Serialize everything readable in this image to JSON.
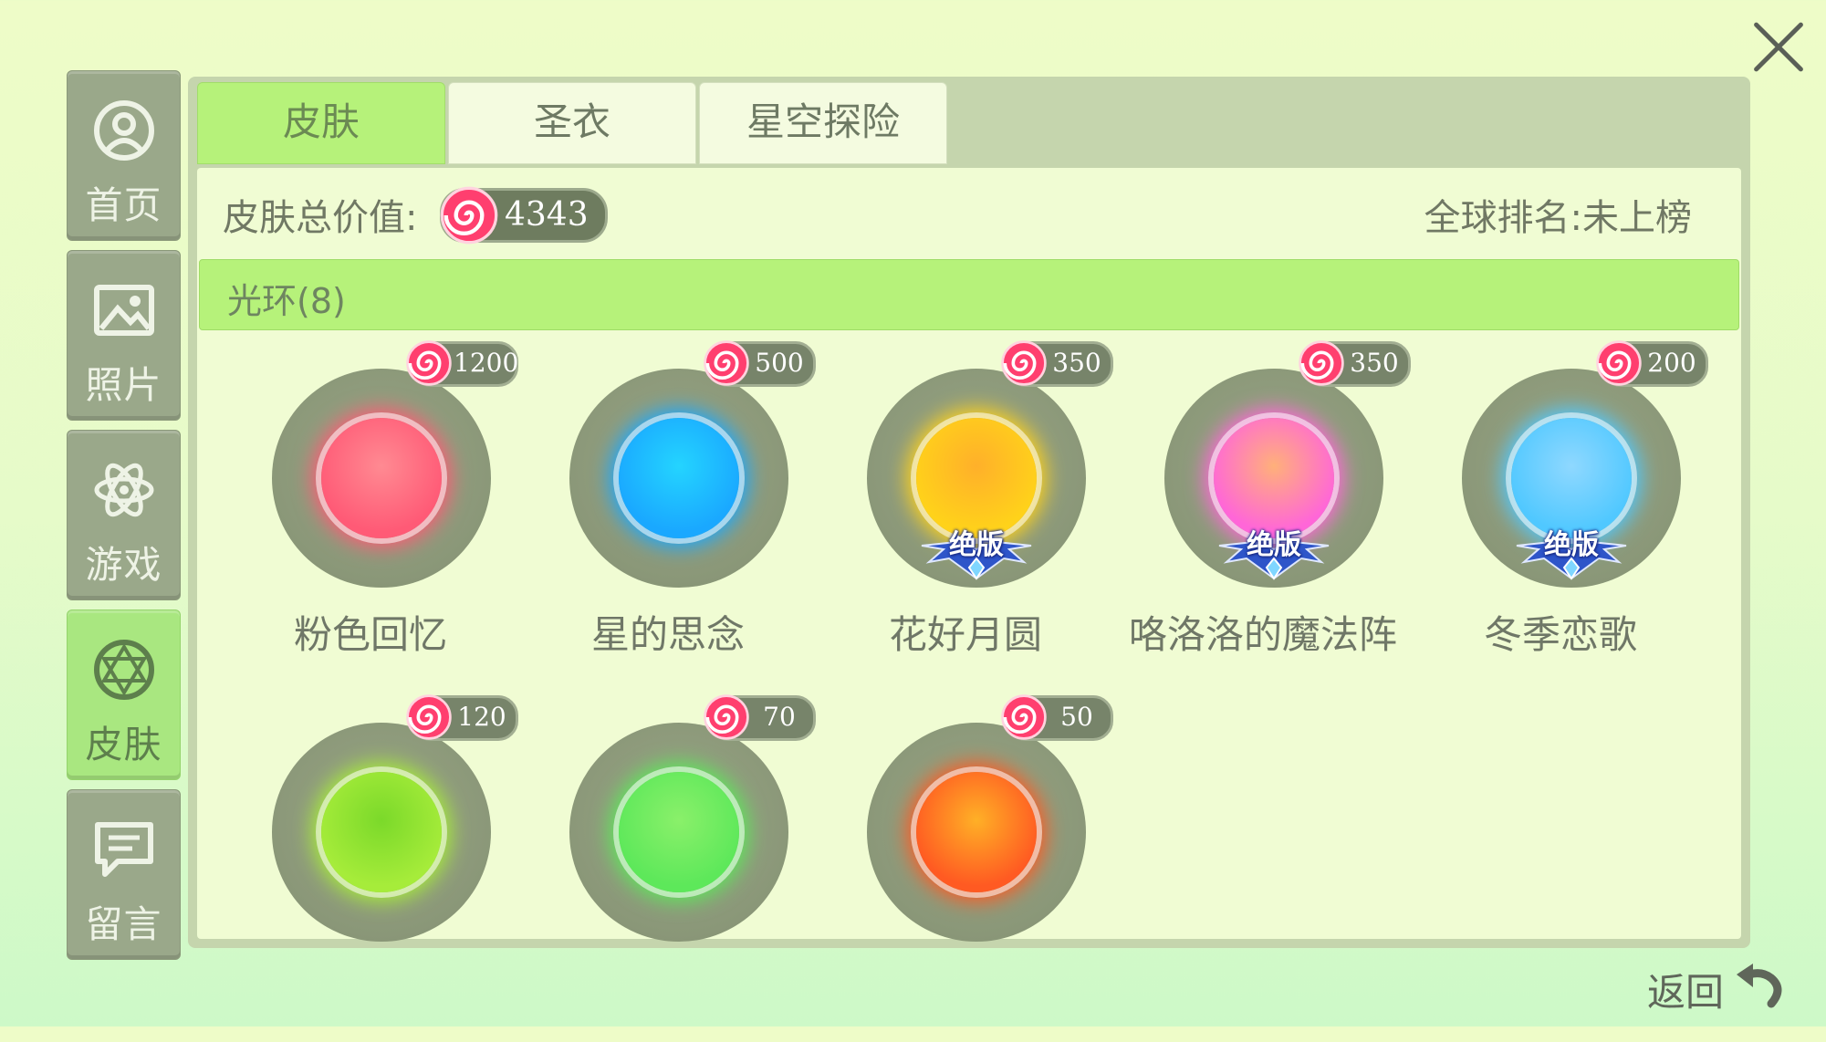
{
  "sidebar": {
    "items": [
      {
        "label": "首页",
        "icon": "profile-icon"
      },
      {
        "label": "照片",
        "icon": "photo-icon"
      },
      {
        "label": "游戏",
        "icon": "atom-icon"
      },
      {
        "label": "皮肤",
        "icon": "gem-icon",
        "active": true
      },
      {
        "label": "留言",
        "icon": "message-icon"
      }
    ]
  },
  "tabs": [
    {
      "label": "皮肤",
      "active": true
    },
    {
      "label": "圣衣"
    },
    {
      "label": "星空探险"
    }
  ],
  "summary": {
    "label": "皮肤总价值:",
    "value": "4343",
    "rank": "全球排名:未上榜"
  },
  "category": {
    "label": "光环(8)"
  },
  "halos": [
    {
      "name": "粉色回忆",
      "price": "1200",
      "badge": "",
      "colors": [
        "#ff5a76",
        "#ff8a92"
      ]
    },
    {
      "name": "星的思念",
      "price": "500",
      "badge": "",
      "colors": [
        "#1aa8ff",
        "#24d4ff"
      ]
    },
    {
      "name": "花好月圆",
      "price": "350",
      "badge": "绝版",
      "colors": [
        "#ffd21a",
        "#ffb02a"
      ]
    },
    {
      "name": "咯洛洛的魔法阵",
      "price": "350",
      "badge": "绝版",
      "colors": [
        "#ff66d8",
        "#ffb07a"
      ]
    },
    {
      "name": "冬季恋歌",
      "price": "200",
      "badge": "绝版",
      "colors": [
        "#50c8ff",
        "#8fd8ff"
      ]
    },
    {
      "name": "",
      "price": "120",
      "badge": "",
      "colors": [
        "#a6ec3a",
        "#7bd92a"
      ]
    },
    {
      "name": "",
      "price": "70",
      "badge": "",
      "colors": [
        "#5de85a",
        "#8af06a"
      ]
    },
    {
      "name": "",
      "price": "50",
      "badge": "",
      "colors": [
        "#ff5a22",
        "#ffb026"
      ]
    }
  ],
  "back": {
    "label": "返回"
  },
  "close": {
    "icon": "close-icon"
  }
}
